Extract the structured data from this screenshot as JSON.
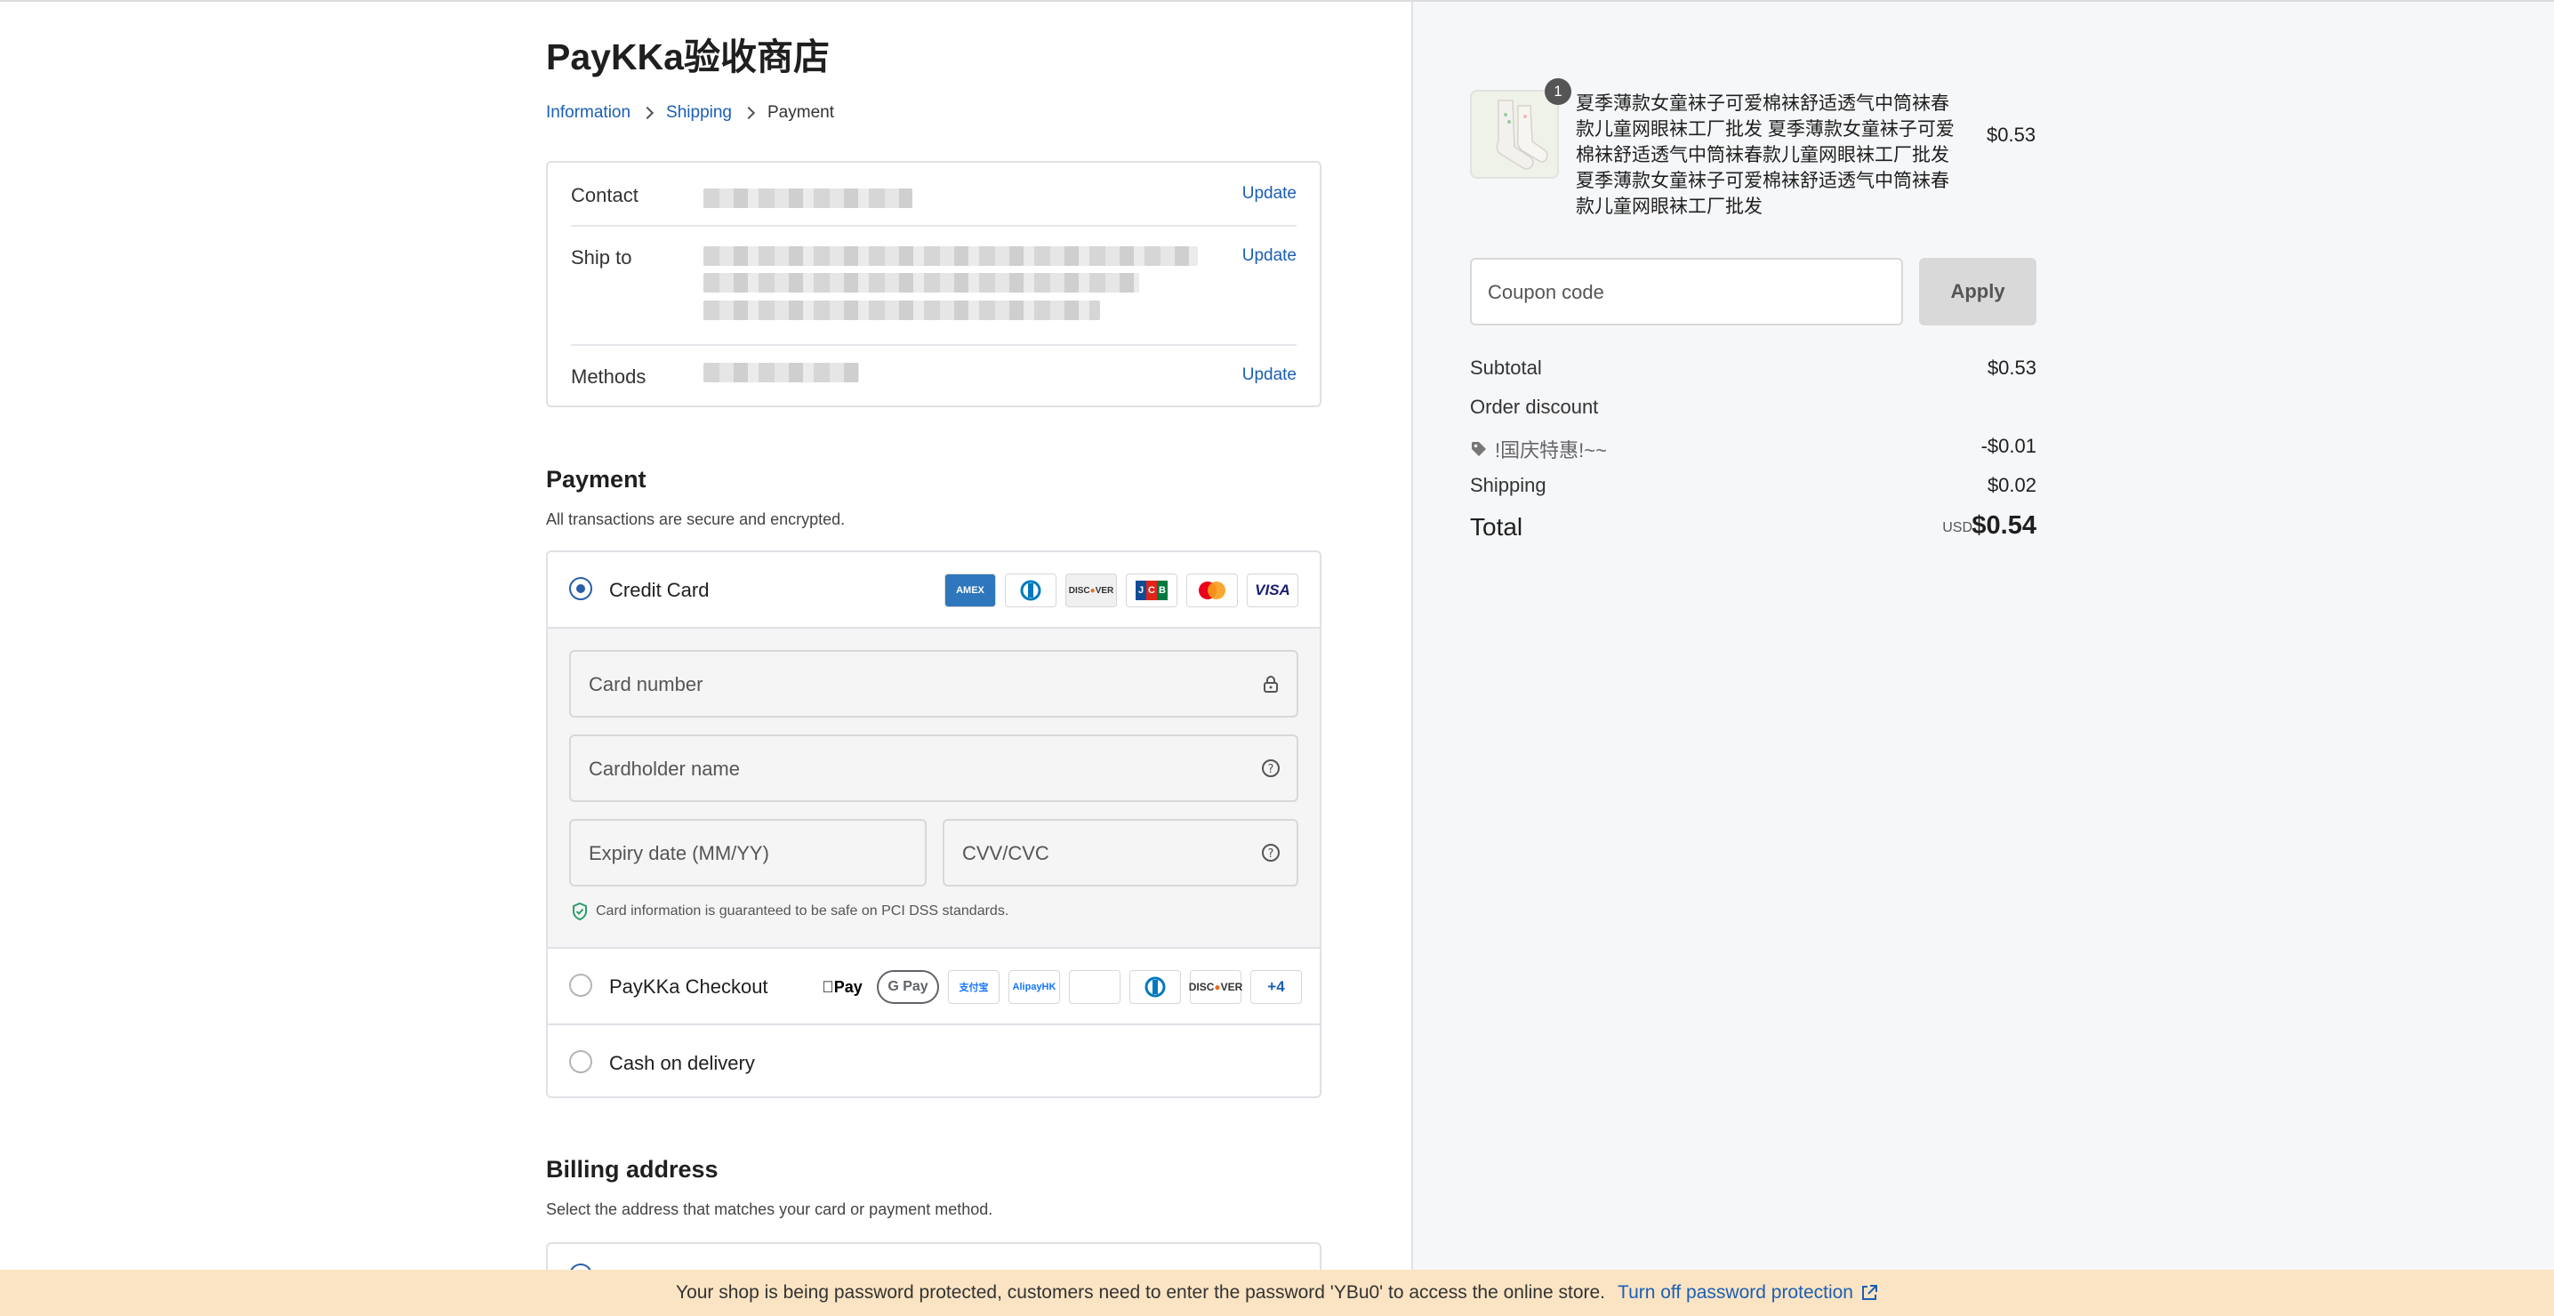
{
  "shop": {
    "title": "PayKKa验收商店"
  },
  "breadcrumb": {
    "information": "Information",
    "shipping": "Shipping",
    "payment": "Payment"
  },
  "review": {
    "contact_label": "Contact",
    "ship_to_label": "Ship to",
    "methods_label": "Methods",
    "update_label": "Update"
  },
  "payment": {
    "title": "Payment",
    "subtitle": "All transactions are secure and encrypted.",
    "credit_card_label": "Credit Card",
    "card_brands": [
      "AMEX",
      "Diners",
      "DISCOVER",
      "JCB",
      "Mastercard",
      "VISA"
    ],
    "card_number_placeholder": "Card number",
    "cardholder_placeholder": "Cardholder name",
    "expiry_placeholder": "Expiry date (MM/YY)",
    "cvv_placeholder": "CVV/CVC",
    "pci_note": "Card information is guaranteed to be safe on PCI DSS standards.",
    "paykka_label": "PayKKa Checkout",
    "paykka_more": "+4",
    "cod_label": "Cash on delivery"
  },
  "billing": {
    "title": "Billing address",
    "subtitle": "Select the address that matches your card or payment method."
  },
  "banner": {
    "message": "Your shop is being password protected, customers need to enter the password 'YBu0' to access the online store.",
    "link": "Turn off password protection"
  },
  "order": {
    "quantity": "1",
    "product_name": "夏季薄款女童袜子可爱棉袜舒适透气中筒袜春款儿童网眼袜工厂批发 夏季薄款女童袜子可爱棉袜舒适透气中筒袜春款儿童网眼袜工厂批发 夏季薄款女童袜子可爱棉袜舒适透气中筒袜春款儿童网眼袜工厂批发",
    "product_price": "$0.53",
    "coupon_placeholder": "Coupon code",
    "apply_label": "Apply",
    "subtotal_label": "Subtotal",
    "subtotal_value": "$0.53",
    "order_discount_label": "Order discount",
    "discount_code": "!国庆特惠!~~",
    "discount_value": "-$0.01",
    "shipping_label": "Shipping",
    "shipping_value": "$0.02",
    "total_label": "Total",
    "currency": "USD",
    "total_value": "$0.54"
  },
  "colors": {
    "link": "#1a5fb4",
    "radio_selected": "#2a5fa8",
    "banner_bg": "#fbe4c3",
    "sidebar_bg": "#f6f7f9"
  }
}
